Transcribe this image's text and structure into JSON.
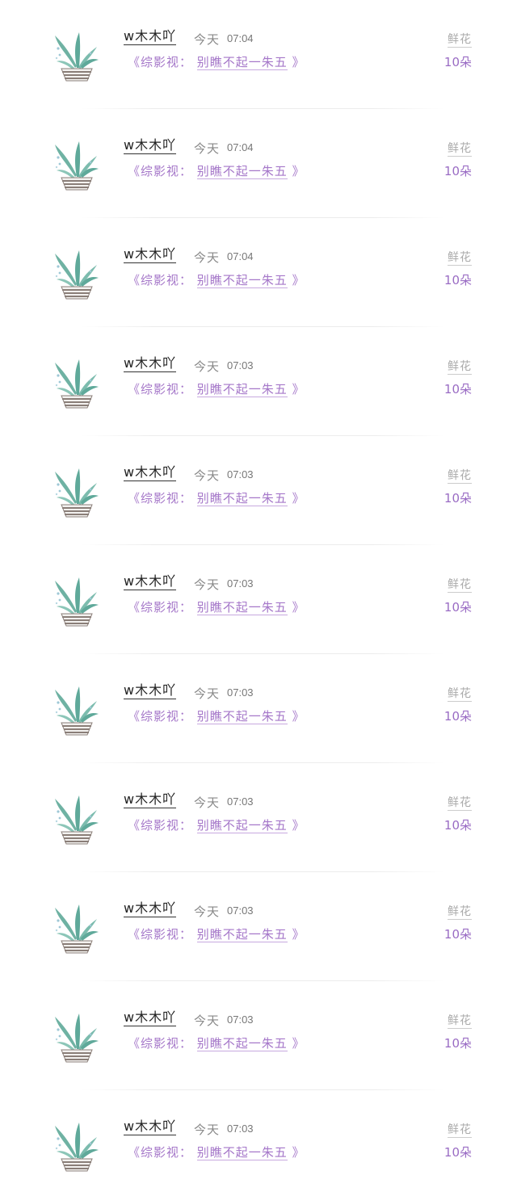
{
  "items": [
    {
      "name": "w木木吖",
      "time_label": "今天",
      "time": "07:04",
      "book_prefix": "《综影视：",
      "book_title": "别瞧不起一朱五",
      "book_suffix": "》",
      "gift_label": "鲜花",
      "gift_count": "10朵"
    },
    {
      "name": "w木木吖",
      "time_label": "今天",
      "time": "07:04",
      "book_prefix": "《综影视：",
      "book_title": "别瞧不起一朱五",
      "book_suffix": "》",
      "gift_label": "鲜花",
      "gift_count": "10朵"
    },
    {
      "name": "w木木吖",
      "time_label": "今天",
      "time": "07:04",
      "book_prefix": "《综影视：",
      "book_title": "别瞧不起一朱五",
      "book_suffix": "》",
      "gift_label": "鲜花",
      "gift_count": "10朵"
    },
    {
      "name": "w木木吖",
      "time_label": "今天",
      "time": "07:03",
      "book_prefix": "《综影视：",
      "book_title": "别瞧不起一朱五",
      "book_suffix": "》",
      "gift_label": "鲜花",
      "gift_count": "10朵"
    },
    {
      "name": "w木木吖",
      "time_label": "今天",
      "time": "07:03",
      "book_prefix": "《综影视：",
      "book_title": "别瞧不起一朱五",
      "book_suffix": "》",
      "gift_label": "鲜花",
      "gift_count": "10朵"
    },
    {
      "name": "w木木吖",
      "time_label": "今天",
      "time": "07:03",
      "book_prefix": "《综影视：",
      "book_title": "别瞧不起一朱五",
      "book_suffix": "》",
      "gift_label": "鲜花",
      "gift_count": "10朵"
    },
    {
      "name": "w木木吖",
      "time_label": "今天",
      "time": "07:03",
      "book_prefix": "《综影视：",
      "book_title": "别瞧不起一朱五",
      "book_suffix": "》",
      "gift_label": "鲜花",
      "gift_count": "10朵"
    },
    {
      "name": "w木木吖",
      "time_label": "今天",
      "time": "07:03",
      "book_prefix": "《综影视：",
      "book_title": "别瞧不起一朱五",
      "book_suffix": "》",
      "gift_label": "鲜花",
      "gift_count": "10朵"
    },
    {
      "name": "w木木吖",
      "time_label": "今天",
      "time": "07:03",
      "book_prefix": "《综影视：",
      "book_title": "别瞧不起一朱五",
      "book_suffix": "》",
      "gift_label": "鲜花",
      "gift_count": "10朵"
    },
    {
      "name": "w木木吖",
      "time_label": "今天",
      "time": "07:03",
      "book_prefix": "《综影视：",
      "book_title": "别瞧不起一朱五",
      "book_suffix": "》",
      "gift_label": "鲜花",
      "gift_count": "10朵"
    },
    {
      "name": "w木木吖",
      "time_label": "今天",
      "time": "07:03",
      "book_prefix": "《综影视：",
      "book_title": "别瞧不起一朱五",
      "book_suffix": "》",
      "gift_label": "鲜花",
      "gift_count": "10朵"
    }
  ],
  "colors": {
    "accent_purple": "#a577c9",
    "plant_green": "#5fa99a",
    "pot_brown": "#8a7e78"
  },
  "icons": {
    "avatar": "potted-plant-icon"
  }
}
